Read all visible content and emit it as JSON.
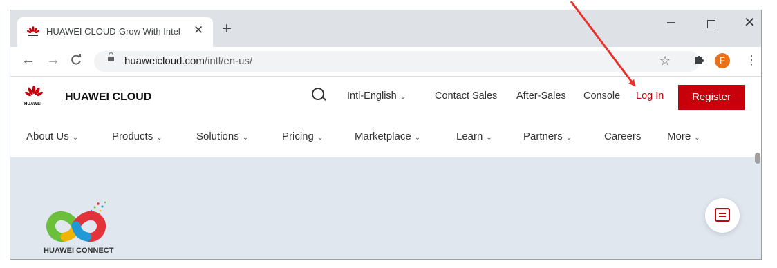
{
  "browser": {
    "tab_title": "HUAWEI CLOUD-Grow With Intel",
    "tab_close": "✕",
    "new_tab": "+",
    "window_controls": {
      "minimize": "–",
      "maximize": "",
      "close": "✕"
    },
    "nav": {
      "back": "←",
      "forward": "→",
      "reload": "C"
    },
    "url_host": "huaweicloud.com",
    "url_path": "/intl/en-us/",
    "bookmark_star": "☆",
    "extensions_icon": "puzzle-icon",
    "profile_initial": "F",
    "menu": "⋮"
  },
  "header": {
    "brand": "HUAWEI CLOUD",
    "logo_text": "HUAWEI",
    "language": "Intl-English",
    "contact_sales": "Contact Sales",
    "after_sales": "After-Sales",
    "console": "Console",
    "login": "Log In",
    "register": "Register"
  },
  "mainnav": {
    "items": [
      {
        "label": "About Us",
        "chevron": "⌄"
      },
      {
        "label": "Products",
        "chevron": "⌄"
      },
      {
        "label": "Solutions",
        "chevron": "⌄"
      },
      {
        "label": "Pricing",
        "chevron": "⌄"
      },
      {
        "label": "Marketplace",
        "chevron": "⌄"
      },
      {
        "label": "Learn",
        "chevron": "⌄"
      },
      {
        "label": "Partners",
        "chevron": "⌄"
      },
      {
        "label": "Careers",
        "chevron": ""
      },
      {
        "label": "More",
        "chevron": "⌄"
      }
    ]
  },
  "hero": {
    "connect_label": "HUAWEI CONNECT"
  },
  "colors": {
    "brand_red": "#c7000b",
    "hero_bg": "#e0e7ef",
    "annotation_arrow": "#e8302a"
  }
}
